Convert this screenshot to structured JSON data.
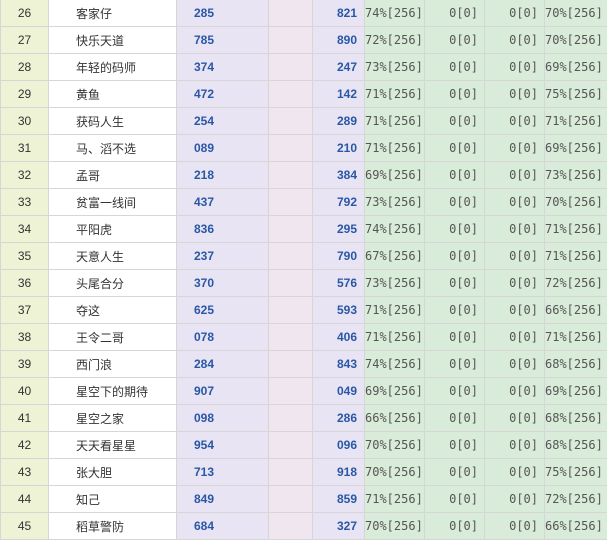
{
  "rows": [
    {
      "num": "26",
      "name": "客家仔",
      "v1": "285",
      "v2": "821",
      "p1": "74%[256]",
      "z1": "0[0]",
      "z2": "0[0]",
      "p2": "70%[256]"
    },
    {
      "num": "27",
      "name": "快乐天道",
      "v1": "785",
      "v2": "890",
      "p1": "72%[256]",
      "z1": "0[0]",
      "z2": "0[0]",
      "p2": "70%[256]"
    },
    {
      "num": "28",
      "name": "年轻的码师",
      "v1": "374",
      "v2": "247",
      "p1": "73%[256]",
      "z1": "0[0]",
      "z2": "0[0]",
      "p2": "69%[256]"
    },
    {
      "num": "29",
      "name": "黄鱼",
      "v1": "472",
      "v2": "142",
      "p1": "71%[256]",
      "z1": "0[0]",
      "z2": "0[0]",
      "p2": "75%[256]"
    },
    {
      "num": "30",
      "name": "获码人生",
      "v1": "254",
      "v2": "289",
      "p1": "71%[256]",
      "z1": "0[0]",
      "z2": "0[0]",
      "p2": "71%[256]"
    },
    {
      "num": "31",
      "name": "马、滔不选",
      "v1": "089",
      "v2": "210",
      "p1": "71%[256]",
      "z1": "0[0]",
      "z2": "0[0]",
      "p2": "69%[256]"
    },
    {
      "num": "32",
      "name": "孟哥",
      "v1": "218",
      "v2": "384",
      "p1": "69%[256]",
      "z1": "0[0]",
      "z2": "0[0]",
      "p2": "73%[256]"
    },
    {
      "num": "33",
      "name": "贫富一线间",
      "v1": "437",
      "v2": "792",
      "p1": "73%[256]",
      "z1": "0[0]",
      "z2": "0[0]",
      "p2": "70%[256]"
    },
    {
      "num": "34",
      "name": "平阳虎",
      "v1": "836",
      "v2": "295",
      "p1": "74%[256]",
      "z1": "0[0]",
      "z2": "0[0]",
      "p2": "71%[256]"
    },
    {
      "num": "35",
      "name": "天意人生",
      "v1": "237",
      "v2": "790",
      "p1": "67%[256]",
      "z1": "0[0]",
      "z2": "0[0]",
      "p2": "71%[256]"
    },
    {
      "num": "36",
      "name": "头尾合分",
      "v1": "370",
      "v2": "576",
      "p1": "73%[256]",
      "z1": "0[0]",
      "z2": "0[0]",
      "p2": "72%[256]"
    },
    {
      "num": "37",
      "name": "夺这",
      "v1": "625",
      "v2": "593",
      "p1": "71%[256]",
      "z1": "0[0]",
      "z2": "0[0]",
      "p2": "66%[256]"
    },
    {
      "num": "38",
      "name": "王令二哥",
      "v1": "078",
      "v2": "406",
      "p1": "71%[256]",
      "z1": "0[0]",
      "z2": "0[0]",
      "p2": "71%[256]"
    },
    {
      "num": "39",
      "name": "西门浪",
      "v1": "284",
      "v2": "843",
      "p1": "74%[256]",
      "z1": "0[0]",
      "z2": "0[0]",
      "p2": "68%[256]"
    },
    {
      "num": "40",
      "name": "星空下的期待",
      "v1": "907",
      "v2": "049",
      "p1": "69%[256]",
      "z1": "0[0]",
      "z2": "0[0]",
      "p2": "69%[256]"
    },
    {
      "num": "41",
      "name": "星空之家",
      "v1": "098",
      "v2": "286",
      "p1": "66%[256]",
      "z1": "0[0]",
      "z2": "0[0]",
      "p2": "68%[256]"
    },
    {
      "num": "42",
      "name": "天天看星星",
      "v1": "954",
      "v2": "096",
      "p1": "70%[256]",
      "z1": "0[0]",
      "z2": "0[0]",
      "p2": "68%[256]"
    },
    {
      "num": "43",
      "name": "张大胆",
      "v1": "713",
      "v2": "918",
      "p1": "70%[256]",
      "z1": "0[0]",
      "z2": "0[0]",
      "p2": "75%[256]"
    },
    {
      "num": "44",
      "name": "知己",
      "v1": "849",
      "v2": "859",
      "p1": "71%[256]",
      "z1": "0[0]",
      "z2": "0[0]",
      "p2": "72%[256]"
    },
    {
      "num": "45",
      "name": "稻草警防",
      "v1": "684",
      "v2": "327",
      "p1": "70%[256]",
      "z1": "0[0]",
      "z2": "0[0]",
      "p2": "66%[256]"
    }
  ]
}
